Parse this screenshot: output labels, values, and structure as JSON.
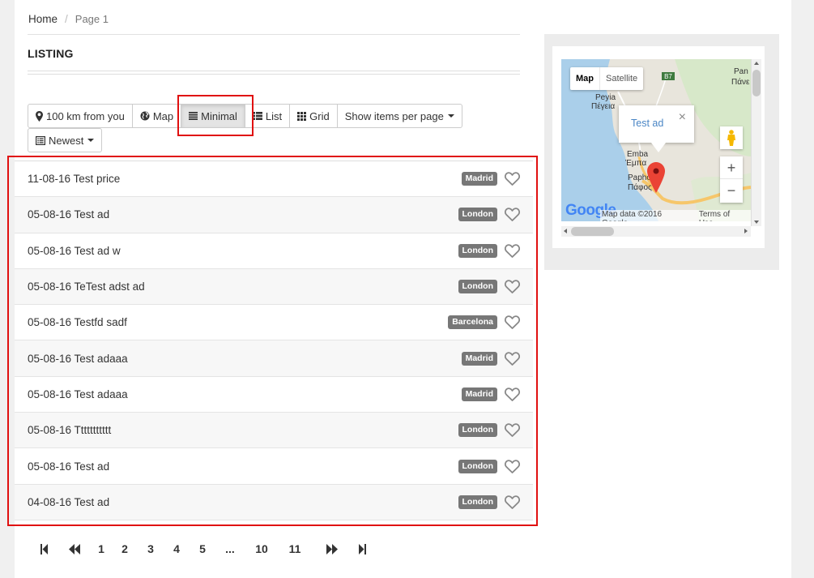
{
  "breadcrumb": {
    "home": "Home",
    "current": "Page 1"
  },
  "heading": "LISTING",
  "toolbar": {
    "distance": "100 km from you",
    "map": "Map",
    "minimal": "Minimal",
    "list": "List",
    "grid": "Grid",
    "per_page": "Show items per page",
    "sort": "Newest",
    "active": "Minimal"
  },
  "listings": [
    {
      "title": "11-08-16 Test price",
      "city": "Madrid"
    },
    {
      "title": "05-08-16 Test ad",
      "city": "London"
    },
    {
      "title": "05-08-16 Test ad w",
      "city": "London"
    },
    {
      "title": "05-08-16 TeTest adst ad",
      "city": "London"
    },
    {
      "title": "05-08-16 Testfd sadf",
      "city": "Barcelona"
    },
    {
      "title": "05-08-16 Test adaaa",
      "city": "Madrid"
    },
    {
      "title": "05-08-16 Test adaaa",
      "city": "Madrid"
    },
    {
      "title": "05-08-16 Ttttttttttt",
      "city": "London"
    },
    {
      "title": "05-08-16 Test ad",
      "city": "London"
    },
    {
      "title": "04-08-16 Test ad",
      "city": "London"
    }
  ],
  "pagination": [
    "1",
    "2",
    "3",
    "4",
    "5",
    "...",
    "10",
    "11"
  ],
  "map": {
    "type_map": "Map",
    "type_satellite": "Satellite",
    "infowindow": "Test ad",
    "close": "×",
    "zoom_in": "+",
    "zoom_out": "−",
    "attribution": "Map data ©2016 Google",
    "terms": "Terms of Use",
    "logo": "Google",
    "road_label": "B7",
    "places": [
      "Peyia",
      "Πέγεια",
      "Emba",
      "Έμπα",
      "Paphos",
      "Πάφος",
      "Pan",
      "Πάνε"
    ]
  },
  "colors": {
    "badge": "#777777",
    "highlight": "#e01010",
    "link": "#4a86c5"
  }
}
